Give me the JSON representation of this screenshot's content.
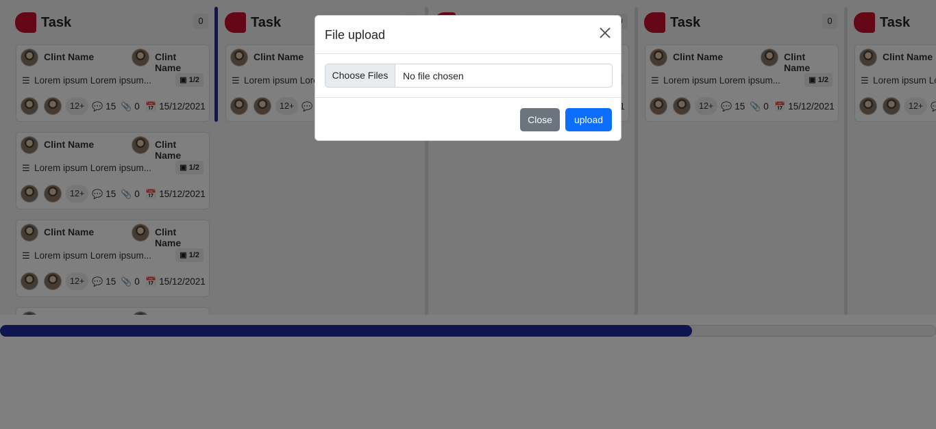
{
  "column": {
    "title": "Task",
    "count": "0"
  },
  "card": {
    "assignee": "Clint Name",
    "description": "Lorem ipsum Lorem ipsum...",
    "checklist": "1/2",
    "extra_members": "12+",
    "comments": "15",
    "attachments": "0",
    "due_date": "15/12/2021"
  },
  "modal": {
    "title": "File upload",
    "choose_label": "Choose Files",
    "file_status": "No file chosen",
    "close_label": "Close",
    "upload_label": "upload"
  },
  "scroll": {
    "horizontal_position": 0.74
  },
  "colors": {
    "accent": "#1f2a9e",
    "badge": "#c8102e",
    "upload": "#0d6efd",
    "close": "#6c757d"
  }
}
